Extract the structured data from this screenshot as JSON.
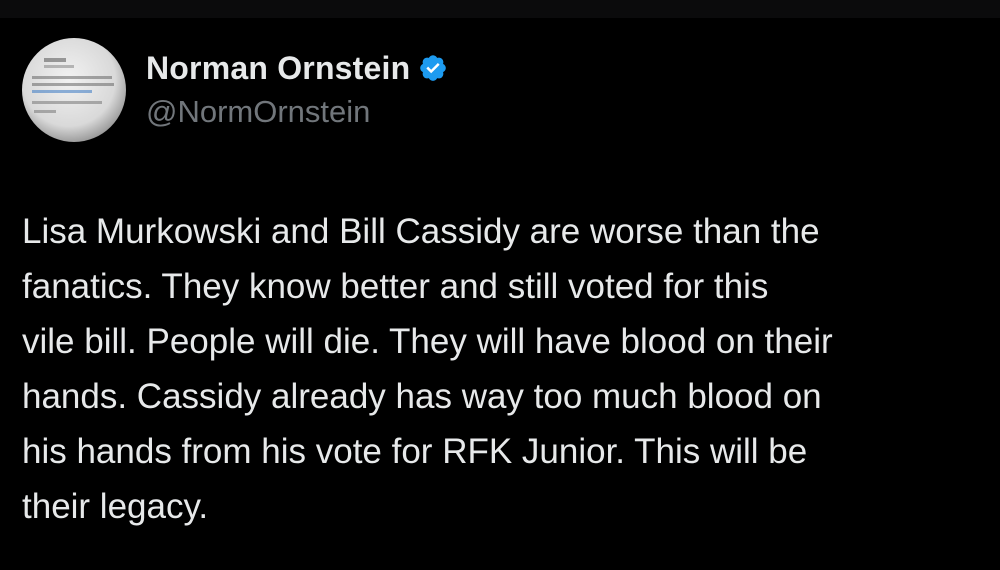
{
  "tweet": {
    "author": {
      "display_name": "Norman Ornstein",
      "handle": "@NormOrnstein",
      "verified": true,
      "verified_icon": "verified-badge-icon",
      "verified_color": "#1d9bf0",
      "avatar_icon": "avatar-screenshot-image"
    },
    "lines": [
      "Lisa Murkowski and Bill Cassidy are worse than the",
      "fanatics. They know better and still voted for this",
      "vile bill. People will die. They will have blood on their",
      "hands. Cassidy already has way too much blood on",
      "his hands from his vote for RFK Junior. This will be",
      "their legacy."
    ]
  },
  "colors": {
    "background": "#000000",
    "text_primary": "#e7e9ea",
    "text_secondary": "#71767b",
    "accent": "#1d9bf0"
  }
}
